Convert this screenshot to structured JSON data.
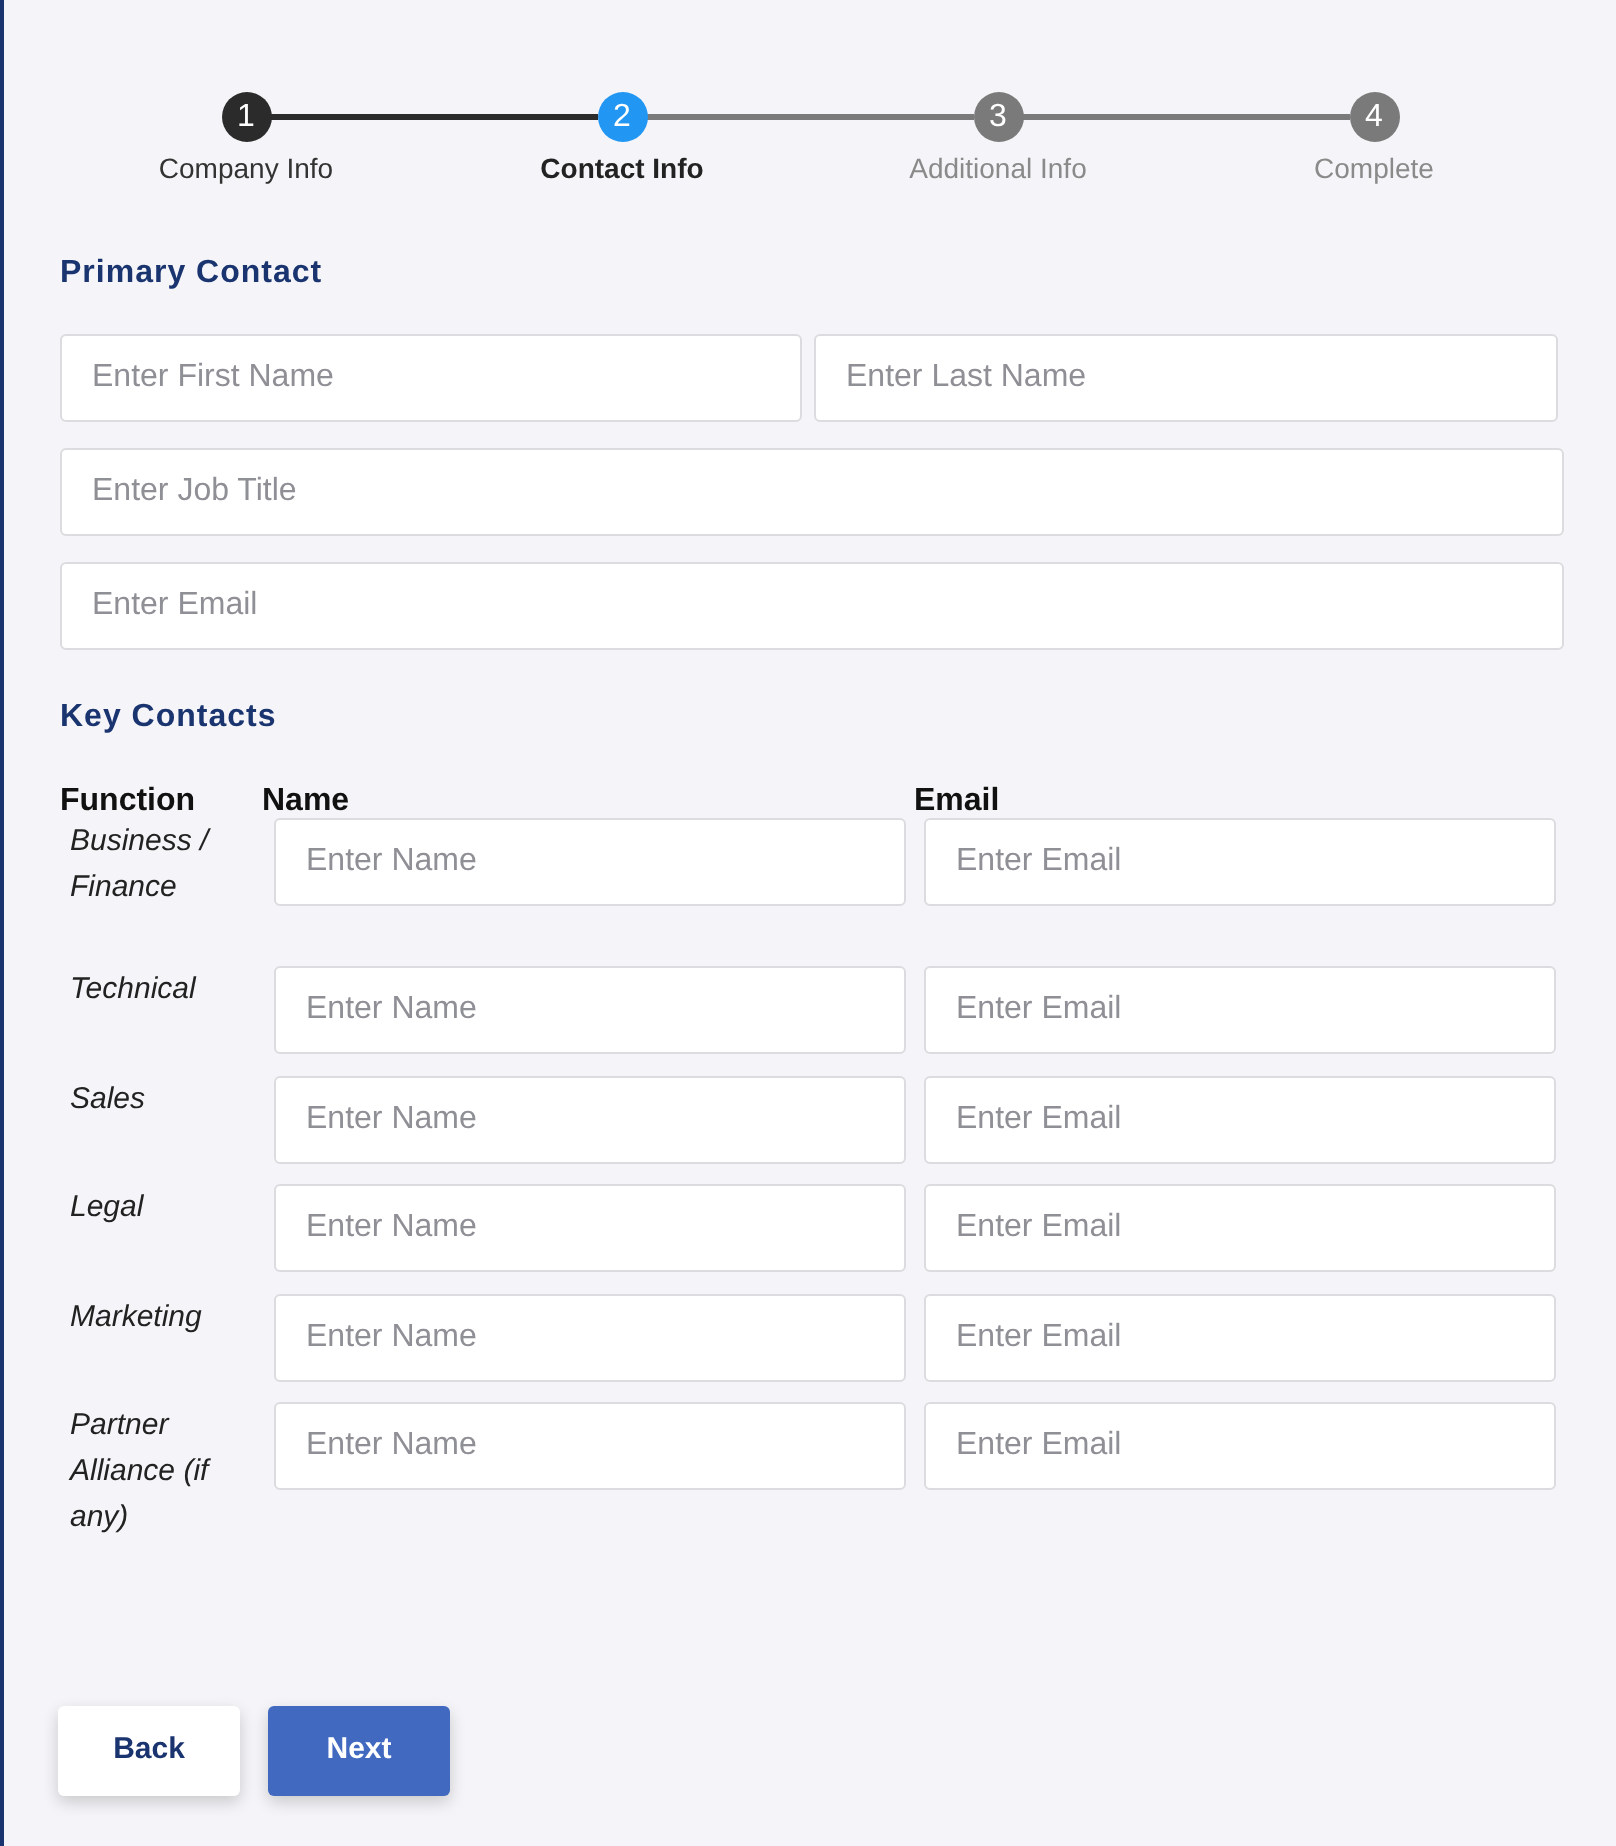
{
  "steps": [
    {
      "number": "1",
      "label": "Company Info",
      "kind": "done"
    },
    {
      "number": "2",
      "label": "Contact Info",
      "kind": "current"
    },
    {
      "number": "3",
      "label": "Additional Info",
      "kind": "upcoming"
    },
    {
      "number": "4",
      "label": "Complete",
      "kind": "upcoming"
    }
  ],
  "primary_contact": {
    "title": "Primary Contact",
    "first_name": {
      "placeholder": "Enter First Name"
    },
    "last_name": {
      "placeholder": "Enter Last Name"
    },
    "job_title": {
      "placeholder": "Enter Job Title"
    },
    "email": {
      "placeholder": "Enter Email"
    }
  },
  "key_contacts": {
    "title": "Key Contacts",
    "columns": [
      "Function",
      "Name",
      "Email"
    ],
    "rows": [
      {
        "function": "Business / Finance",
        "name": {
          "placeholder": "Enter Name"
        },
        "email": {
          "placeholder": "Enter Email"
        }
      },
      {
        "function": "Technical",
        "name": {
          "placeholder": "Enter Name"
        },
        "email": {
          "placeholder": "Enter Email"
        }
      },
      {
        "function": "Sales",
        "name": {
          "placeholder": "Enter Name"
        },
        "email": {
          "placeholder": "Enter Email"
        }
      },
      {
        "function": "Legal",
        "name": {
          "placeholder": "Enter Name"
        },
        "email": {
          "placeholder": "Enter Email"
        }
      },
      {
        "function": "Marketing",
        "name": {
          "placeholder": "Enter Name"
        },
        "email": {
          "placeholder": "Enter Email"
        }
      },
      {
        "function": "Partner Alliance (if any)",
        "name": {
          "placeholder": "Enter Name"
        },
        "email": {
          "placeholder": "Enter Email"
        }
      }
    ]
  },
  "buttons": [
    {
      "label": "Back",
      "kind": "secondary"
    },
    {
      "label": "Next",
      "kind": "primary"
    }
  ]
}
